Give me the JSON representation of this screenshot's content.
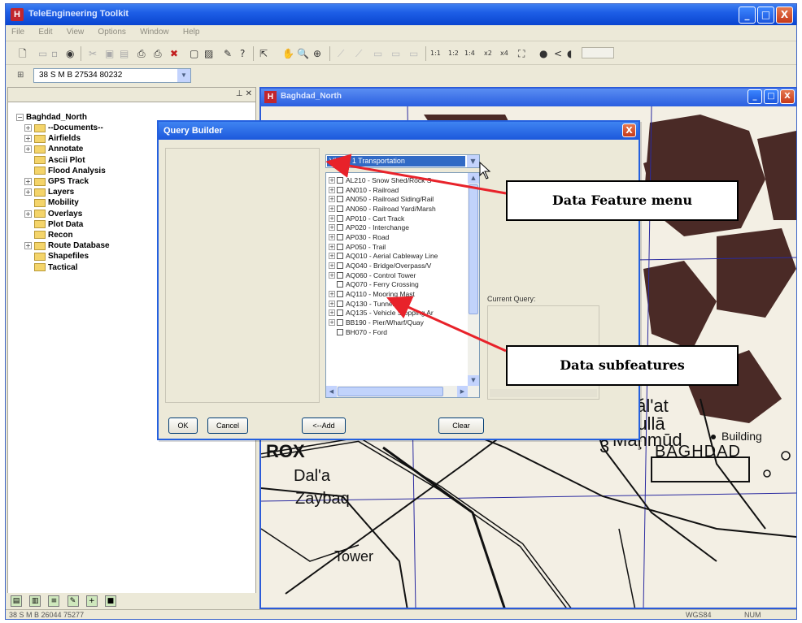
{
  "app": {
    "title": "TeleEngineering Toolkit",
    "icon_letter": "H",
    "window_controls": [
      "_",
      "□",
      "X"
    ]
  },
  "menubar": {
    "items": [
      "File",
      "Edit",
      "View",
      "Options",
      "Window",
      "Help"
    ]
  },
  "toolbar": {
    "scale_buttons": [
      "1:1",
      "1:2",
      "1:4",
      "x2",
      "x4"
    ]
  },
  "coordinate_box": {
    "value": "38 S M B 27534 80232"
  },
  "tree": {
    "root": "Baghdad_North",
    "items": [
      {
        "label": "--Documents--",
        "expandable": true
      },
      {
        "label": "Airfields",
        "expandable": true
      },
      {
        "label": "Annotate",
        "expandable": true
      },
      {
        "label": "Ascii Plot",
        "expandable": false
      },
      {
        "label": "Flood Analysis",
        "expandable": false
      },
      {
        "label": "GPS Track",
        "expandable": true
      },
      {
        "label": "Layers",
        "expandable": true
      },
      {
        "label": "Mobility",
        "expandable": false
      },
      {
        "label": "Overlays",
        "expandable": true
      },
      {
        "label": "Plot Data",
        "expandable": false
      },
      {
        "label": "Recon",
        "expandable": false
      },
      {
        "label": "Route Database",
        "expandable": true
      },
      {
        "label": "Shapefiles",
        "expandable": false
      },
      {
        "label": "Tactical",
        "expandable": false
      }
    ]
  },
  "map": {
    "title": "Baghdad_North",
    "labels": [
      "Qal'at",
      "Mullā",
      "Maḩmūd",
      "Building",
      "Dal'a",
      "Zaybaq",
      "Tower",
      "BAGHDAD",
      "ROX",
      "3"
    ]
  },
  "query_builder": {
    "title": "Query Builder",
    "close_glyph": "X",
    "feature_menu_value": "VMAP 1 Transportation",
    "subfeatures": [
      {
        "label": "AL210 - Snow Shed/Rock S",
        "expandable": true
      },
      {
        "label": "AN010 - Railroad",
        "expandable": true
      },
      {
        "label": "AN050 - Railroad Siding/Rail",
        "expandable": true
      },
      {
        "label": "AN060 - Railroad Yard/Marsh",
        "expandable": true
      },
      {
        "label": "AP010 - Cart Track",
        "expandable": true
      },
      {
        "label": "AP020 - Interchange",
        "expandable": true
      },
      {
        "label": "AP030 - Road",
        "expandable": true
      },
      {
        "label": "AP050 - Trail",
        "expandable": true
      },
      {
        "label": "AQ010 - Aerial Cableway Line",
        "expandable": true
      },
      {
        "label": "AQ040 - Bridge/Overpass/V",
        "expandable": true
      },
      {
        "label": "AQ060 - Control Tower",
        "expandable": true
      },
      {
        "label": "AQ070 - Ferry Crossing",
        "expandable": false
      },
      {
        "label": "AQ110 - Mooring Mast",
        "expandable": true
      },
      {
        "label": "AQ130 - Tunnel",
        "expandable": true
      },
      {
        "label": "AQ135 - Vehicle Stopping Ar",
        "expandable": true
      },
      {
        "label": "BB190 - Pier/Wharf/Quay",
        "expandable": true
      },
      {
        "label": "BH070 - Ford",
        "expandable": false
      }
    ],
    "current_query_label": "Current Query:",
    "buttons": {
      "ok": "OK",
      "cancel": "Cancel",
      "add": "<--Add",
      "clear": "Clear"
    }
  },
  "callouts": {
    "feature_menu": "Data Feature menu",
    "subfeatures": "Data subfeatures"
  },
  "statusbar": {
    "coords": "38 S M B 26044 75277",
    "datum": "WGS84",
    "num": "NUM"
  },
  "colors": {
    "titlebar": "#1d5ee6",
    "dialog_bg": "#ece9d8",
    "selection": "#316ac5",
    "arrow": "#e8222a",
    "urban_area": "#4a2a26"
  }
}
